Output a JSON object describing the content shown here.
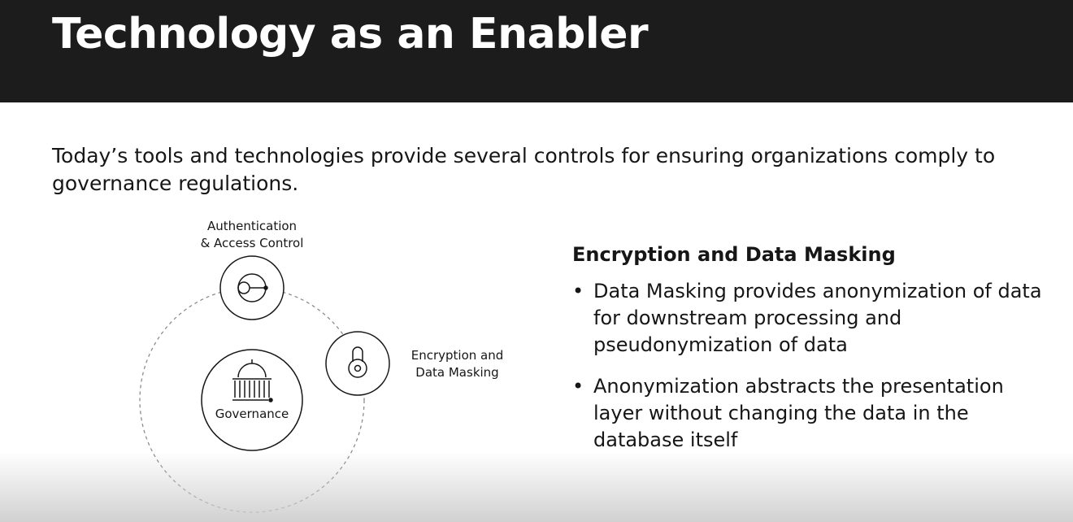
{
  "slide": {
    "title": "Technology as an Enabler",
    "intro": "Today’s tools and technologies provide several controls for ensuring organizations comply to governance regulations."
  },
  "diagram": {
    "auth_label": "Authentication\n& Access Control",
    "encryption_label": "Encryption and\nData Masking",
    "center_label": "Governance",
    "icons": [
      "user-key-icon",
      "lock-icon",
      "government-building-icon"
    ]
  },
  "panel": {
    "heading": "Encryption and Data Masking",
    "bullet_glyph": "•",
    "bullets": [
      "Data Masking provides anonymization of data for downstream processing and pseudonymization of data",
      "Anonymization abstracts the presentation layer without changing the data in the database itself"
    ]
  },
  "colors": {
    "header_bg": "#1c1c1c",
    "title_text": "#ffffff",
    "body_text": "#161616",
    "stroke": "#161616",
    "orbit": "#8c8c8c"
  }
}
